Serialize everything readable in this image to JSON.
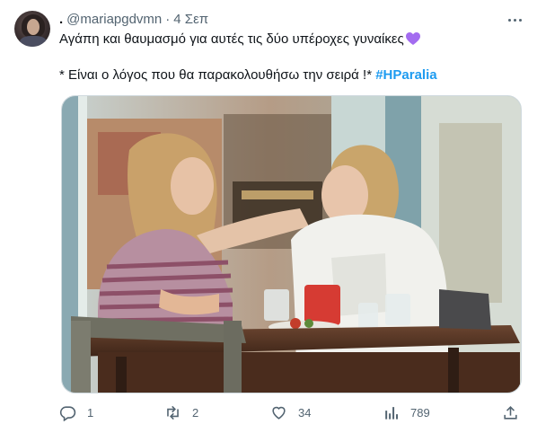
{
  "tweet": {
    "author_display_name": ".",
    "author_handle": "@mariapgdvmn",
    "separator": "·",
    "timestamp": "4 Σεπ",
    "text_line1": "Αγάπη και θαυμασμό για αυτές τις δύο υπέροχες γυναίκες",
    "text_line2_prefix": "* Είναι ο λόγος που θα παρακολουθήσω την σειρά !* ",
    "hashtag": "#HParalia",
    "emoji": "purple-heart-icon"
  },
  "actions": {
    "replies": "1",
    "retweets": "2",
    "likes": "34",
    "views": "789"
  },
  "colors": {
    "text_primary": "#0f1419",
    "text_secondary": "#536471",
    "link": "#1d9bf0",
    "heart": "#a36cf0",
    "border": "#cfd9de"
  }
}
